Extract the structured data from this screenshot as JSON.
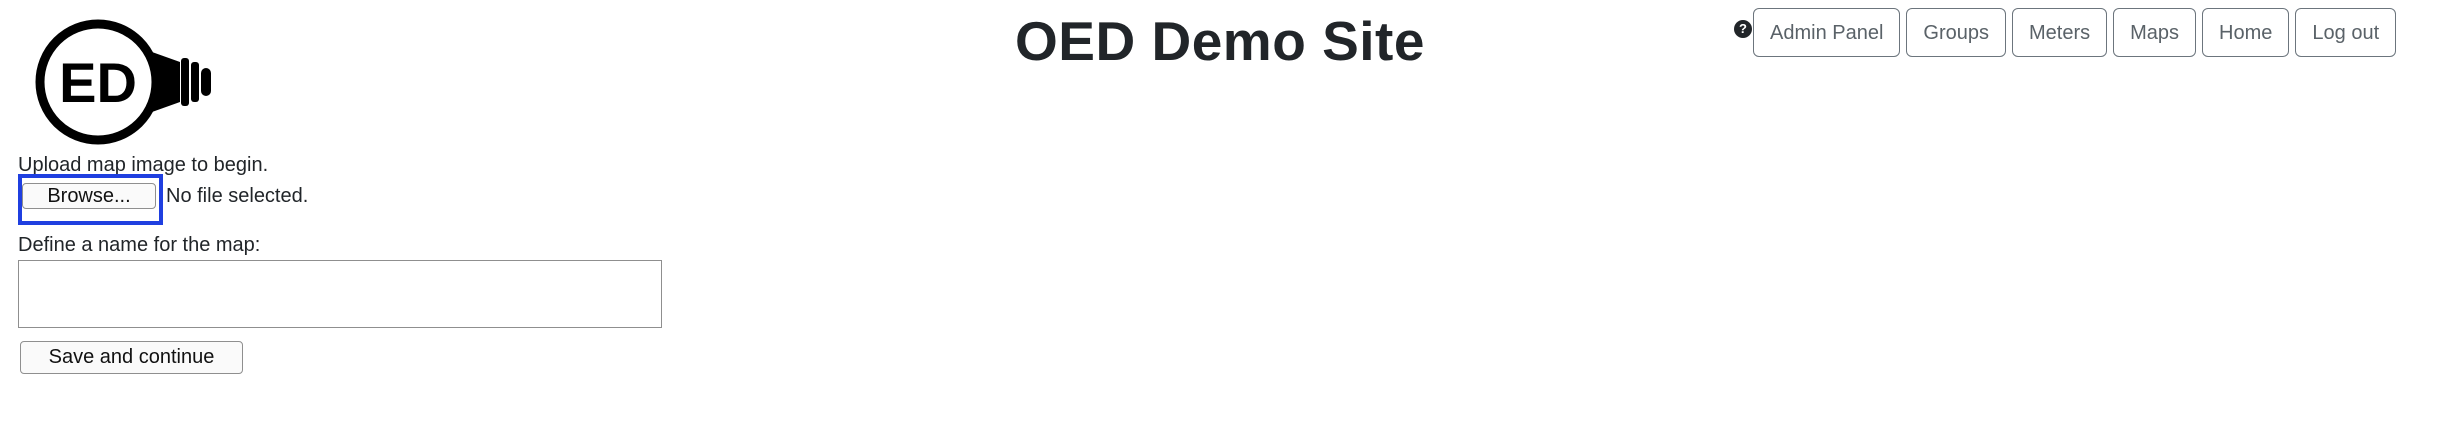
{
  "header": {
    "logo_icon": "ed-lightbulb-logo",
    "logo_text": "ED",
    "title": "OED Demo Site",
    "help_icon": "question-circle-icon",
    "help_symbol": "?",
    "nav": [
      {
        "label": "Admin Panel"
      },
      {
        "label": "Groups"
      },
      {
        "label": "Meters"
      },
      {
        "label": "Maps"
      },
      {
        "label": "Home"
      },
      {
        "label": "Log out"
      }
    ]
  },
  "form": {
    "upload_prompt": "Upload map image to begin.",
    "browse_label": "Browse...",
    "file_status": "No file selected.",
    "name_label": "Define a name for the map:",
    "name_value": "",
    "save_label": "Save and continue"
  },
  "colors": {
    "highlight": "#1f3fe0",
    "nav_border": "#6c757d"
  }
}
